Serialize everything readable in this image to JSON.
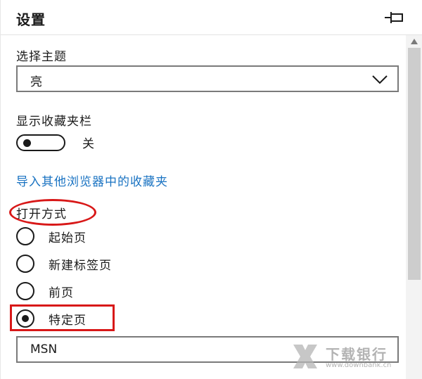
{
  "header": {
    "title": "设置",
    "pin_icon": "pin-icon"
  },
  "theme": {
    "label": "选择主题",
    "selected": "亮",
    "dropdown_icon": "chevron-down-icon"
  },
  "favorites_bar": {
    "label": "显示收藏夹栏",
    "state_label": "关",
    "on": false
  },
  "import_link": "导入其他浏览器中的收藏夹",
  "open_with": {
    "label": "打开方式",
    "options": [
      {
        "label": "起始页",
        "selected": false
      },
      {
        "label": "新建标签页",
        "selected": false
      },
      {
        "label": "前页",
        "selected": false
      },
      {
        "label": "特定页",
        "selected": true
      }
    ],
    "url_value": "MSN"
  },
  "watermark": {
    "name": "下载银行",
    "url": "www.downbank.cn"
  },
  "colors": {
    "link": "#1a73c2",
    "highlight": "#d81818",
    "scrollbar_thumb": "#cdcdcd"
  }
}
